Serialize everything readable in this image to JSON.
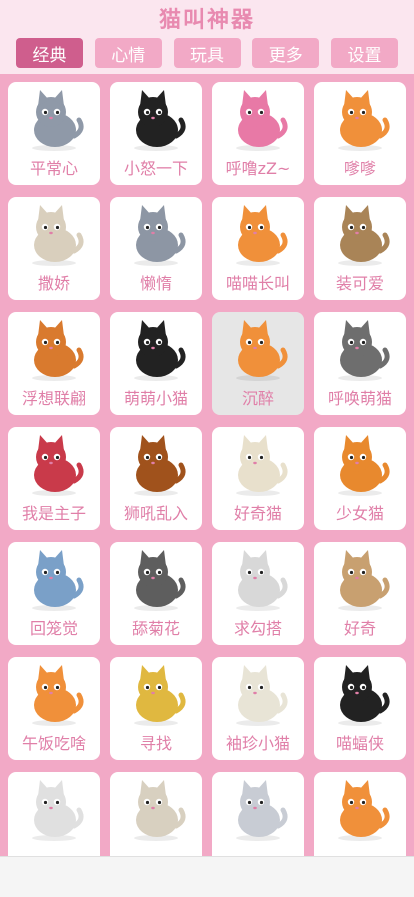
{
  "app": {
    "title": "猫叫神器"
  },
  "tabs": [
    {
      "label": "经典",
      "active": true
    },
    {
      "label": "心情",
      "active": false
    },
    {
      "label": "玩具",
      "active": false
    },
    {
      "label": "更多",
      "active": false
    },
    {
      "label": "设置",
      "active": false
    }
  ],
  "cards": [
    {
      "label": "平常心",
      "icon": "gray-cat-sitting-icon",
      "color": "#8f99a8",
      "selected": false
    },
    {
      "label": "小怒一下",
      "icon": "black-cat-angry-icon",
      "color": "#222222",
      "selected": false
    },
    {
      "label": "呼噜zZ~",
      "icon": "pink-cat-sleeping-icon",
      "color": "#e879a6",
      "selected": false
    },
    {
      "label": "嗲嗲",
      "icon": "orange-cat-dreaming-icon",
      "color": "#f0903a",
      "selected": false
    },
    {
      "label": "撒娇",
      "icon": "cream-cat-icon",
      "color": "#d9cfbd",
      "selected": false
    },
    {
      "label": "懒惰",
      "icon": "gray-cat-lying-icon",
      "color": "#8d96a4",
      "selected": false
    },
    {
      "label": "喵喵长叫",
      "icon": "orange-cat-cage-icon",
      "color": "#f0903a",
      "selected": false
    },
    {
      "label": "装可爱",
      "icon": "cat-in-box-icon",
      "color": "#a98457",
      "selected": false
    },
    {
      "label": "浮想联翩",
      "icon": "cat-yarn-ball-icon",
      "color": "#d97a2e",
      "selected": false
    },
    {
      "label": "萌萌小猫",
      "icon": "black-cat-litter-box-icon",
      "color": "#222222",
      "selected": false
    },
    {
      "label": "沉醉",
      "icon": "orange-cat-jumping-icon",
      "color": "#f0903a",
      "selected": true
    },
    {
      "label": "呼唤萌猫",
      "icon": "gray-tabby-cat-icon",
      "color": "#6e6e6e",
      "selected": false
    },
    {
      "label": "我是主子",
      "icon": "cat-in-basket-icon",
      "color": "#c93a4a",
      "selected": false
    },
    {
      "label": "狮吼乱入",
      "icon": "lion-cat-icon",
      "color": "#a0521c",
      "selected": false
    },
    {
      "label": "好奇猫",
      "icon": "cat-in-vase-icon",
      "color": "#e8e0cc",
      "selected": false
    },
    {
      "label": "少女猫",
      "icon": "cat-in-pumpkin-icon",
      "color": "#e8892e",
      "selected": false
    },
    {
      "label": "回笼觉",
      "icon": "cat-on-laptop-icon",
      "color": "#7aa0c8",
      "selected": false
    },
    {
      "label": "舔菊花",
      "icon": "gray-cat-back-icon",
      "color": "#5e5e5e",
      "selected": false
    },
    {
      "label": "求勾搭",
      "icon": "cat-with-flower-icon",
      "color": "#d8d8d8",
      "selected": false
    },
    {
      "label": "好奇",
      "icon": "cat-gift-box-icon",
      "color": "#c8a070",
      "selected": false
    },
    {
      "label": "午饭吃啥",
      "icon": "cat-food-bowl-icon",
      "color": "#f0903a",
      "selected": false
    },
    {
      "label": "寻找",
      "icon": "cat-dog-house-icon",
      "color": "#e0b840",
      "selected": false
    },
    {
      "label": "袖珍小猫",
      "icon": "ghost-cat-icon",
      "color": "#e8e4d6",
      "selected": false
    },
    {
      "label": "喵蝠侠",
      "icon": "bat-cat-icon",
      "color": "#222222",
      "selected": false
    },
    {
      "label": "",
      "icon": "cat-in-toilet-icon",
      "color": "#e0e0e0",
      "selected": false
    },
    {
      "label": "",
      "icon": "mummy-cat-icon",
      "color": "#d8d0c0",
      "selected": false
    },
    {
      "label": "",
      "icon": "angel-cat-icon",
      "color": "#c8ccd4",
      "selected": false
    },
    {
      "label": "",
      "icon": "orange-cat-hearts-icon",
      "color": "#f0903a",
      "selected": false
    }
  ]
}
